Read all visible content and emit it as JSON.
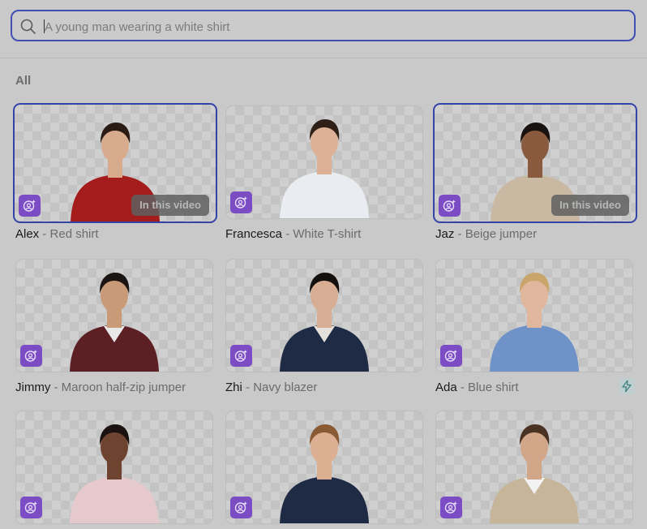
{
  "search": {
    "placeholder": "A young man wearing a white shirt",
    "value": ""
  },
  "section": {
    "title": "All"
  },
  "badge_text": "In this video",
  "colors": {
    "accent_border": "#3443a8",
    "ai_badge": "#7c4cc5"
  },
  "avatars": [
    {
      "name": "Alex",
      "desc": "Red shirt",
      "selected": true,
      "in_video": true,
      "top": "#a51c1c",
      "skin": "#d9ab8e",
      "hair": "#2a1b14",
      "inner": "#a51c1c"
    },
    {
      "name": "Francesca",
      "desc": "White T-shirt",
      "selected": false,
      "in_video": false,
      "top": "#e9edf1",
      "skin": "#dcb196",
      "hair": "#2e1f17",
      "inner": "#e9edf1"
    },
    {
      "name": "Jaz",
      "desc": "Beige jumper",
      "selected": true,
      "in_video": true,
      "top": "#c9b8a2",
      "skin": "#8a5a3e",
      "hair": "#1a1210",
      "inner": "#c9b8a2"
    },
    {
      "name": "Jimmy",
      "desc": "Maroon half-zip jumper",
      "selected": false,
      "in_video": false,
      "top": "#5b1f24",
      "skin": "#c99a77",
      "hair": "#1b1412",
      "inner": "#e8e8e8"
    },
    {
      "name": "Zhi",
      "desc": "Navy blazer",
      "selected": false,
      "in_video": false,
      "top": "#1f2a44",
      "skin": "#d7ae93",
      "hair": "#14100e",
      "inner": "#e6e1da"
    },
    {
      "name": "Ada",
      "desc": "Blue shirt",
      "selected": false,
      "in_video": false,
      "bolt": true,
      "top": "#6f93c9",
      "skin": "#e0b79c",
      "hair": "#c9a46b",
      "inner": "#6f93c9"
    },
    {
      "name": "",
      "desc": "",
      "selected": false,
      "in_video": false,
      "top": "#e6c9cc",
      "skin": "#6e432f",
      "hair": "#1a1210",
      "inner": "#e6c9cc"
    },
    {
      "name": "",
      "desc": "",
      "selected": false,
      "in_video": false,
      "top": "#1f2a44",
      "skin": "#dcae92",
      "hair": "#8a5a34",
      "inner": "#1f2a44"
    },
    {
      "name": "",
      "desc": "",
      "selected": false,
      "in_video": false,
      "top": "#c7b59a",
      "skin": "#d2a689",
      "hair": "#4a3322",
      "inner": "#f2f2f2"
    }
  ]
}
